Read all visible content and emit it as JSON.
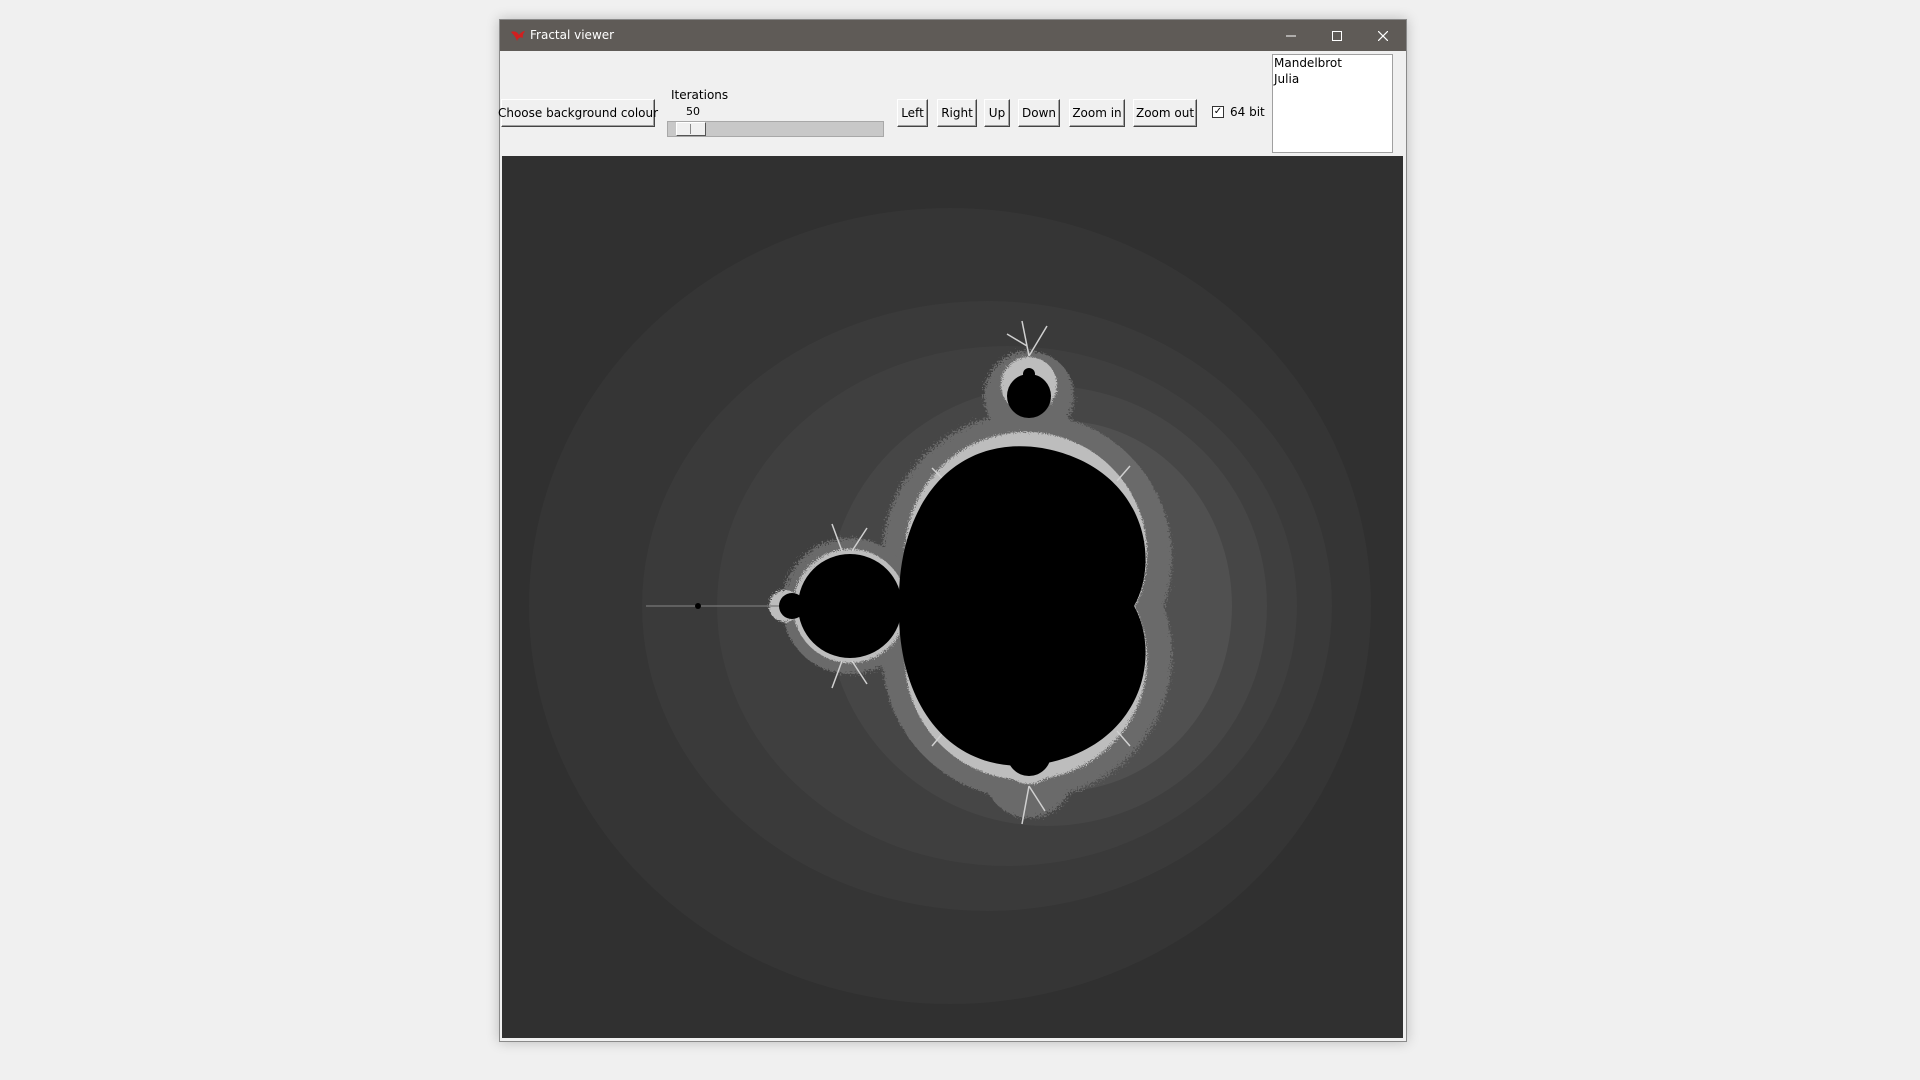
{
  "window": {
    "title": "Fractal viewer"
  },
  "toolbar": {
    "background_button": "Choose background colour",
    "iterations_label": "Iterations",
    "iterations_value": "50",
    "left": "Left",
    "right": "Right",
    "up": "Up",
    "down": "Down",
    "zoom_in": "Zoom in",
    "zoom_out": "Zoom out",
    "bit64_label": "64 bit",
    "bit64_checked": true
  },
  "fractal_list": [
    "Mandelbrot",
    "Julia"
  ],
  "fractal_canvas": {
    "background": "#303030",
    "set_color": "#000000"
  }
}
